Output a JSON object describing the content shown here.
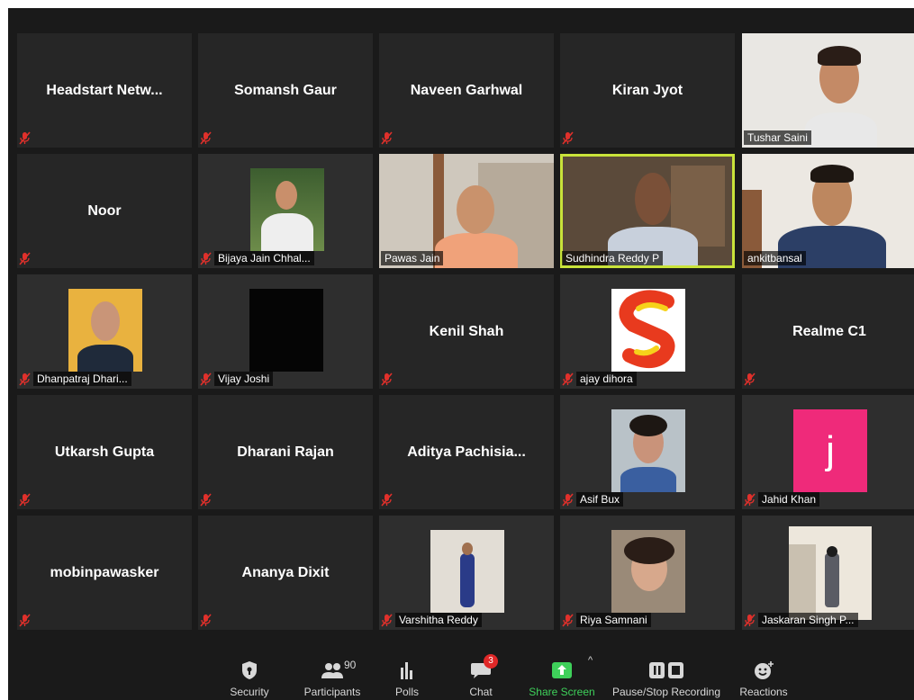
{
  "meeting": {
    "participants": [
      {
        "name": "Headstart Netw...",
        "label": "",
        "muted": true,
        "video": false
      },
      {
        "name": "Somansh Gaur",
        "label": "",
        "muted": true,
        "video": false
      },
      {
        "name": "Naveen Garhwal",
        "label": "",
        "muted": true,
        "video": false
      },
      {
        "name": "Kiran Jyot",
        "label": "",
        "muted": true,
        "video": false
      },
      {
        "name": "",
        "label": "Tushar Saini",
        "muted": false,
        "video": true
      },
      {
        "name": "Noor",
        "label": "",
        "muted": true,
        "video": false
      },
      {
        "name": "",
        "label": "Bijaya Jain Chhal...",
        "muted": true,
        "video": true
      },
      {
        "name": "",
        "label": "Pawas Jain",
        "muted": false,
        "video": true
      },
      {
        "name": "",
        "label": "Sudhindra Reddy P",
        "muted": false,
        "video": true,
        "active_speaker": true
      },
      {
        "name": "",
        "label": "ankitbansal",
        "muted": false,
        "video": true
      },
      {
        "name": "",
        "label": "Dhanpatraj Dhari...",
        "muted": true,
        "video": true
      },
      {
        "name": "",
        "label": "Vijay Joshi",
        "muted": true,
        "video": true
      },
      {
        "name": "Kenil Shah",
        "label": "",
        "muted": true,
        "video": false
      },
      {
        "name": "",
        "label": "ajay dihora",
        "muted": true,
        "video": true
      },
      {
        "name": "Realme C1",
        "label": "",
        "muted": true,
        "video": false
      },
      {
        "name": "Utkarsh Gupta",
        "label": "",
        "muted": true,
        "video": false
      },
      {
        "name": "Dharani Rajan",
        "label": "",
        "muted": true,
        "video": false
      },
      {
        "name": "Aditya  Pachisia...",
        "label": "",
        "muted": true,
        "video": false
      },
      {
        "name": "",
        "label": "Asif Bux",
        "muted": true,
        "video": true
      },
      {
        "name": "",
        "label": "Jahid Khan",
        "muted": true,
        "video": true,
        "avatar_letter": "j"
      },
      {
        "name": "mobinpawasker",
        "label": "",
        "muted": true,
        "video": false
      },
      {
        "name": "Ananya Dixit",
        "label": "",
        "muted": true,
        "video": false
      },
      {
        "name": "",
        "label": "Varshitha Reddy",
        "muted": true,
        "video": true
      },
      {
        "name": "",
        "label": "Riya Samnani",
        "muted": true,
        "video": true
      },
      {
        "name": "",
        "label": "Jaskaran Singh P...",
        "muted": true,
        "video": true
      }
    ]
  },
  "toolbar": {
    "security": {
      "label": "Security",
      "icon": "shield-icon"
    },
    "participants": {
      "label": "Participants",
      "count": "90",
      "icon": "people-icon"
    },
    "polls": {
      "label": "Polls",
      "icon": "bar-chart-icon"
    },
    "chat": {
      "label": "Chat",
      "badge": "3",
      "icon": "chat-bubble-icon"
    },
    "share": {
      "label": "Share Screen",
      "icon": "share-arrow-icon"
    },
    "recording": {
      "label": "Pause/Stop Recording",
      "icon": "pause-stop-icon"
    },
    "reactions": {
      "label": "Reactions",
      "icon": "emoji-icon"
    }
  },
  "colors": {
    "background": "#1a1a1a",
    "tile": "#262626",
    "active_speaker_border": "#c9e33a",
    "mute_red": "#e0302b",
    "share_green": "#3ed05a",
    "badge_red": "#e02828",
    "avatar_pink": "#ef2a7a"
  }
}
